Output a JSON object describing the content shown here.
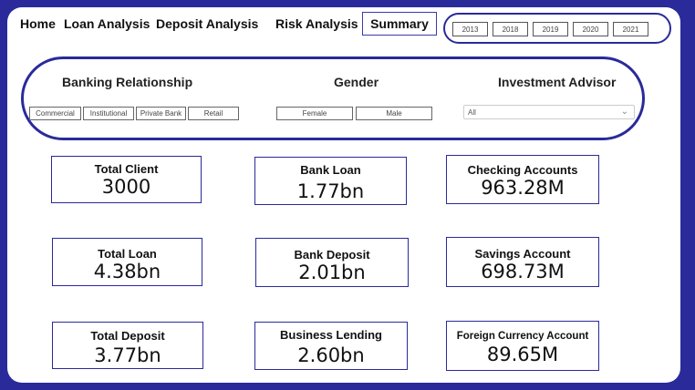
{
  "nav": {
    "home": "Home",
    "loan": "Loan Analysis",
    "deposit": "Deposit Analysis",
    "risk": "Risk Analysis",
    "summary": "Summary"
  },
  "years": [
    "2013",
    "2018",
    "2019",
    "2020",
    "2021"
  ],
  "filters": {
    "relationship_title": "Banking Relationship",
    "relationship_options": [
      "Commercial",
      "Institutional",
      "Private Bank",
      "Retail"
    ],
    "gender_title": "Gender",
    "gender_options": [
      "Female",
      "Male"
    ],
    "advisor_title": "Investment Advisor",
    "advisor_value": "All"
  },
  "cards": {
    "total_client": {
      "title": "Total Client",
      "value": "3000"
    },
    "bank_loan": {
      "title": "Bank Loan",
      "value": "1.77bn"
    },
    "checking": {
      "title": "Checking Accounts",
      "value": "963.28M"
    },
    "total_loan": {
      "title": "Total Loan",
      "value": "4.38bn"
    },
    "bank_deposit": {
      "title": "Bank Deposit",
      "value": "2.01bn"
    },
    "savings": {
      "title": "Savings Account",
      "value": "698.73M"
    },
    "total_deposit": {
      "title": "Total Deposit",
      "value": "3.77bn"
    },
    "business_lending": {
      "title": "Business Lending",
      "value": "2.60bn"
    },
    "foreign_currency": {
      "title": "Foreign Currency Account",
      "value": "89.65M"
    }
  },
  "colors": {
    "accent": "#2a2a9a",
    "background": "#ffffff"
  }
}
